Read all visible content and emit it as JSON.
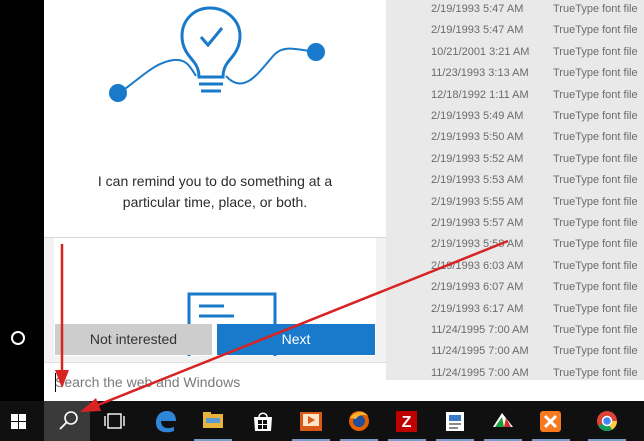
{
  "file_list": {
    "rows": [
      {
        "date": "2/19/1993 5:47 AM",
        "type": "TrueType font file"
      },
      {
        "date": "2/19/1993 5:47 AM",
        "type": "TrueType font file"
      },
      {
        "date": "10/21/2001 3:21 AM",
        "type": "TrueType font file"
      },
      {
        "date": "11/23/1993 3:13 AM",
        "type": "TrueType font file"
      },
      {
        "date": "12/18/1992 1:11 AM",
        "type": "TrueType font file"
      },
      {
        "date": "2/19/1993 5:49 AM",
        "type": "TrueType font file"
      },
      {
        "date": "2/19/1993 5:50 AM",
        "type": "TrueType font file"
      },
      {
        "date": "2/19/1993 5:52 AM",
        "type": "TrueType font file"
      },
      {
        "date": "2/19/1993 5:53 AM",
        "type": "TrueType font file"
      },
      {
        "date": "2/19/1993 5:55 AM",
        "type": "TrueType font file"
      },
      {
        "date": "2/19/1993 5:57 AM",
        "type": "TrueType font file"
      },
      {
        "date": "2/19/1993 5:58 AM",
        "type": "TrueType font file"
      },
      {
        "date": "2/19/1993 6:03 AM",
        "type": "TrueType font file"
      },
      {
        "date": "2/19/1993 6:07 AM",
        "type": "TrueType font file"
      },
      {
        "date": "2/19/1993 6:17 AM",
        "type": "TrueType font file"
      },
      {
        "date": "11/24/1995 7:00 AM",
        "type": "TrueType font file"
      },
      {
        "date": "11/24/1995 7:00 AM",
        "type": "TrueType font file"
      },
      {
        "date": "11/24/1995 7:00 AM",
        "type": "TrueType font file"
      }
    ]
  },
  "cortana": {
    "reminder_text": "I can remind you to do something at a particular time, place, or both.",
    "not_interested_label": "Not interested",
    "next_label": "Next",
    "accent_color": "#1979ca"
  },
  "search": {
    "placeholder": "Search the web and Windows",
    "value": ""
  },
  "taskbar": {
    "items": [
      {
        "icon": "windows-start-icon"
      },
      {
        "icon": "search-icon",
        "active": true
      },
      {
        "icon": "task-view-icon"
      },
      {
        "icon": "edge-browser-icon"
      },
      {
        "icon": "file-explorer-icon"
      },
      {
        "icon": "store-icon"
      },
      {
        "icon": "media-player-icon"
      },
      {
        "icon": "firefox-icon"
      },
      {
        "icon": "filezilla-icon"
      },
      {
        "icon": "notepad-app-icon"
      },
      {
        "icon": "app-icon"
      },
      {
        "icon": "xampp-icon"
      },
      {
        "icon": "chrome-icon"
      }
    ]
  },
  "annotation_color": "#d92222"
}
